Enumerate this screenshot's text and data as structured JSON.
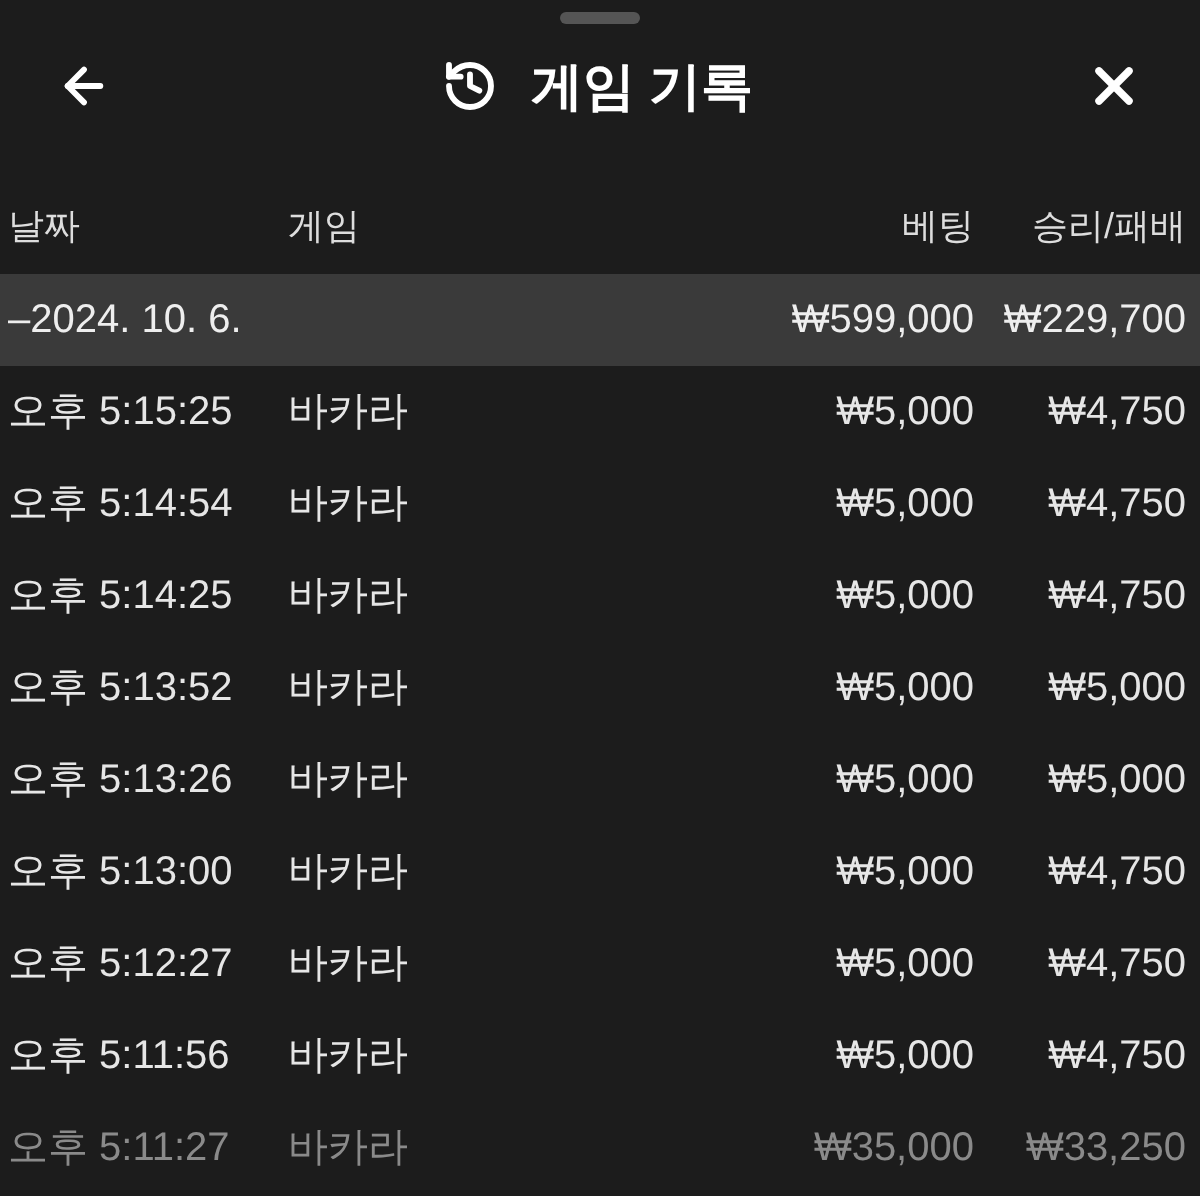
{
  "header": {
    "title": "게임 기록"
  },
  "table": {
    "columns": [
      "날짜",
      "게임",
      "베팅",
      "승리/패배"
    ],
    "group": {
      "date": "–2024. 10. 6.",
      "bet": "₩599,000",
      "result": "₩229,700"
    },
    "rows": [
      {
        "time": "오후 5:15:25",
        "game": "바카라",
        "bet": "₩5,000",
        "result": "₩4,750",
        "faded": false
      },
      {
        "time": "오후 5:14:54",
        "game": "바카라",
        "bet": "₩5,000",
        "result": "₩4,750",
        "faded": false
      },
      {
        "time": "오후 5:14:25",
        "game": "바카라",
        "bet": "₩5,000",
        "result": "₩4,750",
        "faded": false
      },
      {
        "time": "오후 5:13:52",
        "game": "바카라",
        "bet": "₩5,000",
        "result": "₩5,000",
        "faded": false
      },
      {
        "time": "오후 5:13:26",
        "game": "바카라",
        "bet": "₩5,000",
        "result": "₩5,000",
        "faded": false
      },
      {
        "time": "오후 5:13:00",
        "game": "바카라",
        "bet": "₩5,000",
        "result": "₩4,750",
        "faded": false
      },
      {
        "time": "오후 5:12:27",
        "game": "바카라",
        "bet": "₩5,000",
        "result": "₩4,750",
        "faded": false
      },
      {
        "time": "오후 5:11:56",
        "game": "바카라",
        "bet": "₩5,000",
        "result": "₩4,750",
        "faded": false
      },
      {
        "time": "오후 5:11:27",
        "game": "바카라",
        "bet": "₩35,000",
        "result": "₩33,250",
        "faded": true
      }
    ]
  }
}
